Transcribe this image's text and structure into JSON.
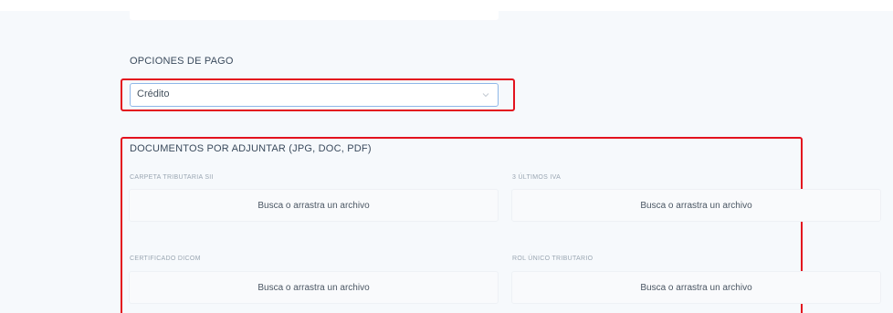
{
  "payment": {
    "section_label": "OPCIONES DE PAGO",
    "selected_option": "Crédito"
  },
  "documents": {
    "title": "DOCUMENTOS POR ADJUNTAR (JPG, DOC, PDF)",
    "items": [
      {
        "label": "CARPETA TRIBUTARIA SII",
        "dropzone_text": "Busca o arrastra un archivo"
      },
      {
        "label": "3 ÚLTIMOS IVA",
        "dropzone_text": "Busca o arrastra un archivo"
      },
      {
        "label": "CERTIFICADO DICOM",
        "dropzone_text": "Busca o arrastra un archivo"
      },
      {
        "label": "ROL ÚNICO TRIBUTARIO",
        "dropzone_text": "Busca o arrastra un archivo"
      }
    ]
  },
  "colors": {
    "highlight": "#e3121e",
    "panel_background": "#f6f9fc",
    "select_border": "#8fb7e8"
  },
  "icons": {
    "select_chevron": "chevron-down-icon"
  }
}
